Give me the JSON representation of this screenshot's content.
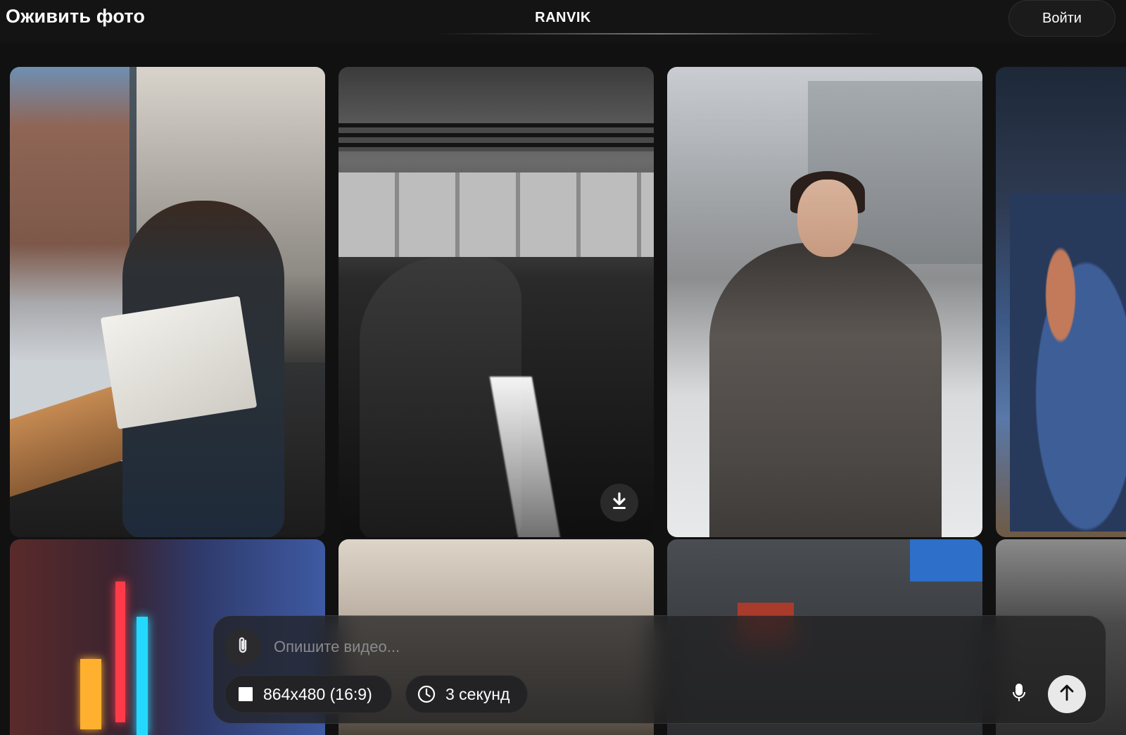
{
  "header": {
    "title": "Оживить фото",
    "brand": "RANVIK",
    "login_label": "Войти"
  },
  "gallery": {
    "tiles": [
      {
        "name": "man-reading-newspaper-photo"
      },
      {
        "name": "welder-sparks-photo",
        "download_icon": "download-icon"
      },
      {
        "name": "woman-in-snow-photo"
      },
      {
        "name": "classroom-photo"
      },
      {
        "name": "neon-street-photo"
      },
      {
        "name": "interior-window-photo"
      },
      {
        "name": "workshop-photo"
      },
      {
        "name": "monochrome-photo"
      }
    ]
  },
  "prompt": {
    "placeholder": "Опишите видео...",
    "value": "",
    "resolution_label": "864x480 (16:9)",
    "duration_label": "3 секунд",
    "icons": {
      "attach": "paperclip-icon",
      "resolution": "square-icon",
      "duration": "clock-icon",
      "mic": "microphone-icon",
      "send": "arrow-up-icon"
    }
  },
  "colors": {
    "background": "#111112",
    "surface": "#232325",
    "send_button": "#e9e9ea"
  }
}
